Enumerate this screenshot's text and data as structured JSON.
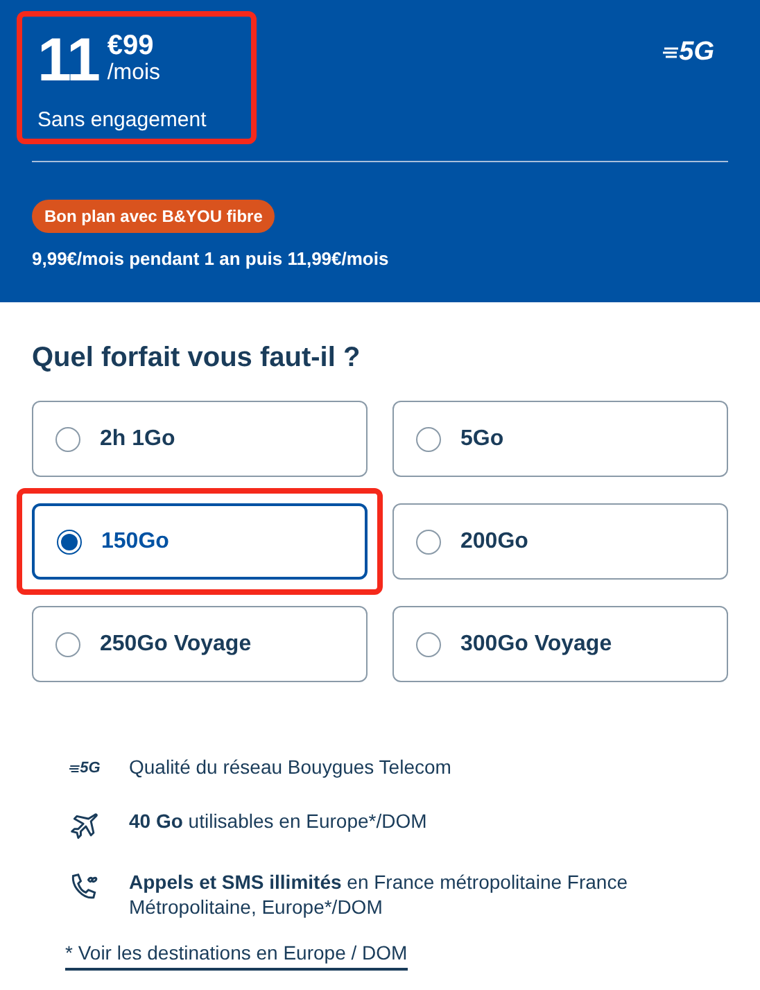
{
  "offer": {
    "price_whole": "11",
    "price_cents": "€99",
    "period": "/mois",
    "commitment": "Sans engagement",
    "highlighted": true,
    "network_badge": "5G",
    "promo_badge": "Bon plan avec B&YOU fibre",
    "promo_text": "9,99€/mois pendant 1 an puis 11,99€/mois"
  },
  "plan_question": "Quel forfait vous faut-il ?",
  "plans": [
    {
      "label": "2h 1Go",
      "selected": false,
      "highlighted": false
    },
    {
      "label": "5Go",
      "selected": false,
      "highlighted": false
    },
    {
      "label": "150Go",
      "selected": true,
      "highlighted": true
    },
    {
      "label": "200Go",
      "selected": false,
      "highlighted": false
    },
    {
      "label": "250Go Voyage",
      "selected": false,
      "highlighted": false
    },
    {
      "label": "300Go Voyage",
      "selected": false,
      "highlighted": false
    }
  ],
  "features": [
    {
      "kind": "network",
      "icon_text": "5G",
      "text": "Qualité du réseau Bouygues Telecom"
    },
    {
      "kind": "travel",
      "text": "**40 Go** utilisables en Europe*/DOM"
    },
    {
      "kind": "calls",
      "text": "**Appels et SMS illimités** en France métropolitaine France Métropolitaine, Europe*/DOM"
    }
  ],
  "destinations_link": "* Voir les destinations en Europe / DOM"
}
